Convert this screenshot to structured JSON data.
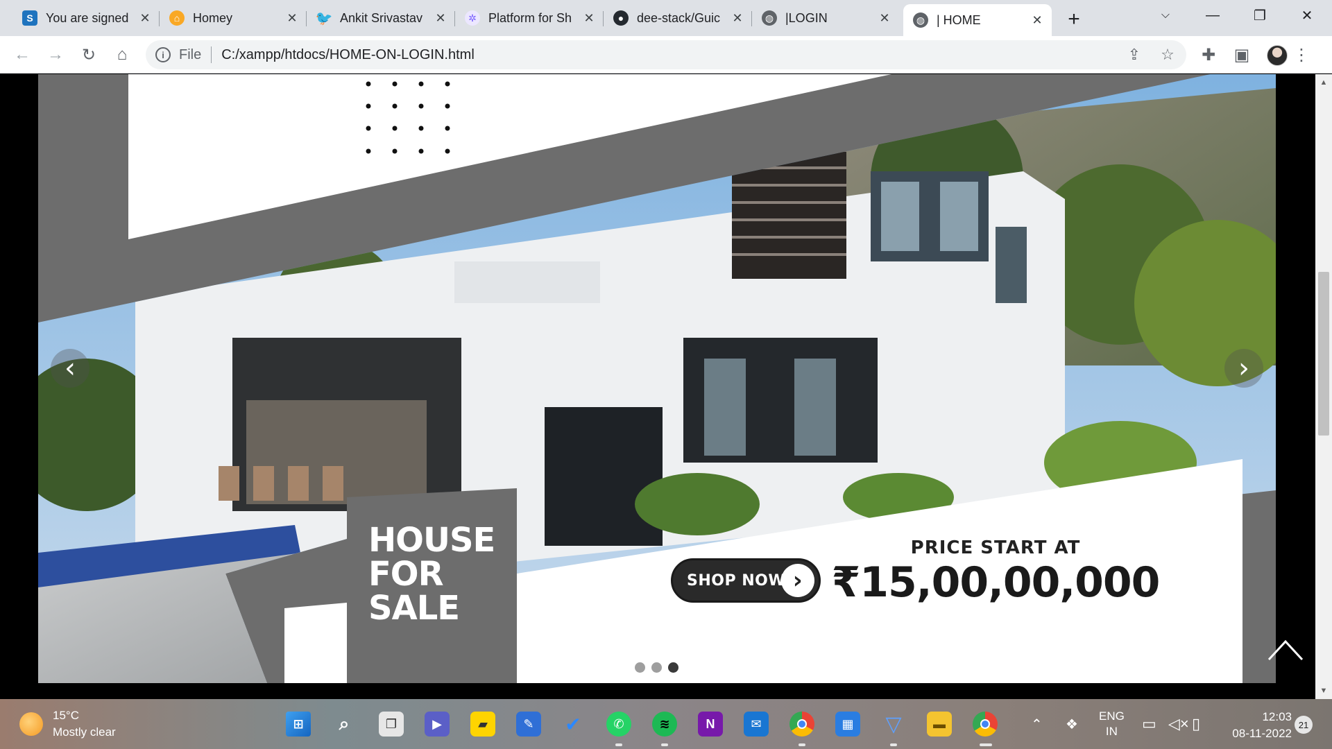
{
  "browser": {
    "tabs": [
      {
        "label": "You are signed",
        "icon": "s-app-icon",
        "color": "#1e73be"
      },
      {
        "label": "Homey",
        "icon": "homey-icon",
        "color": "#f9a825"
      },
      {
        "label": "Ankit Srivastav",
        "icon": "twitter-icon",
        "color": "#1d9bf0"
      },
      {
        "label": "Platform for Sh",
        "icon": "platform-icon",
        "color": "#7b61ff"
      },
      {
        "label": "dee-stack/Guic",
        "icon": "github-icon",
        "color": "#24292f"
      },
      {
        "label": "|LOGIN",
        "icon": "globe-icon",
        "color": "#5f6368"
      },
      {
        "label": "| HOME",
        "icon": "globe-icon",
        "color": "#5f6368"
      }
    ],
    "address": {
      "scheme": "File",
      "url": "C:/xampp/htdocs/HOME-ON-LOGIN.html"
    }
  },
  "hero": {
    "headline_lines": [
      "HOUSE",
      "FOR",
      "SALE"
    ],
    "cta_label": "SHOP NOW",
    "price_label": "PRICE START AT",
    "price": "₹15,00,00,000",
    "slides": 3,
    "active_slide": 3
  },
  "taskbar": {
    "temperature": "15°C",
    "condition": "Mostly clear",
    "language": [
      "ENG",
      "IN"
    ],
    "time": "12:03",
    "date": "08-11-2022",
    "notifications": "21"
  }
}
